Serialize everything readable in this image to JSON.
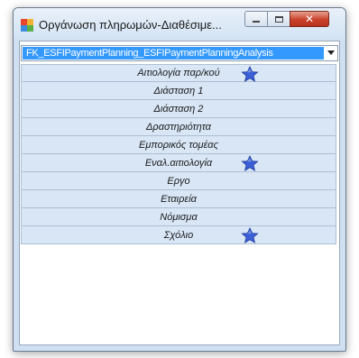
{
  "window": {
    "title": "Οργάνωση πληρωμών-Διαθέσιμε...",
    "controls": {
      "minimize": "minimize",
      "maximize": "maximize",
      "close": "✕"
    }
  },
  "combo": {
    "value": "FK_ESFIPaymentPlanning_ESFIPaymentPlanningAnalysis"
  },
  "list": {
    "items": [
      {
        "label": "Αιτιολογία παρ/κού",
        "starred": true
      },
      {
        "label": "Διάσταση 1",
        "starred": false
      },
      {
        "label": "Διάσταση 2",
        "starred": false
      },
      {
        "label": "Δραστηριότητα",
        "starred": false
      },
      {
        "label": "Εμπορικός τομέας",
        "starred": false
      },
      {
        "label": "Εναλ.αιτιολογία",
        "starred": true
      },
      {
        "label": "Εργο",
        "starred": false
      },
      {
        "label": "Εταιρεία",
        "starred": false
      },
      {
        "label": "Νόμισμα",
        "starred": false
      },
      {
        "label": "Σχόλιο",
        "starred": true
      }
    ]
  },
  "colors": {
    "selection": "#3399ff",
    "list_item_bg": "#d8e6f6",
    "star": "#3b5fd6",
    "close_button": "#c9422b"
  },
  "icons": {
    "app": "app-icon",
    "star": "star-icon",
    "dropdown": "chevron-down-icon"
  }
}
